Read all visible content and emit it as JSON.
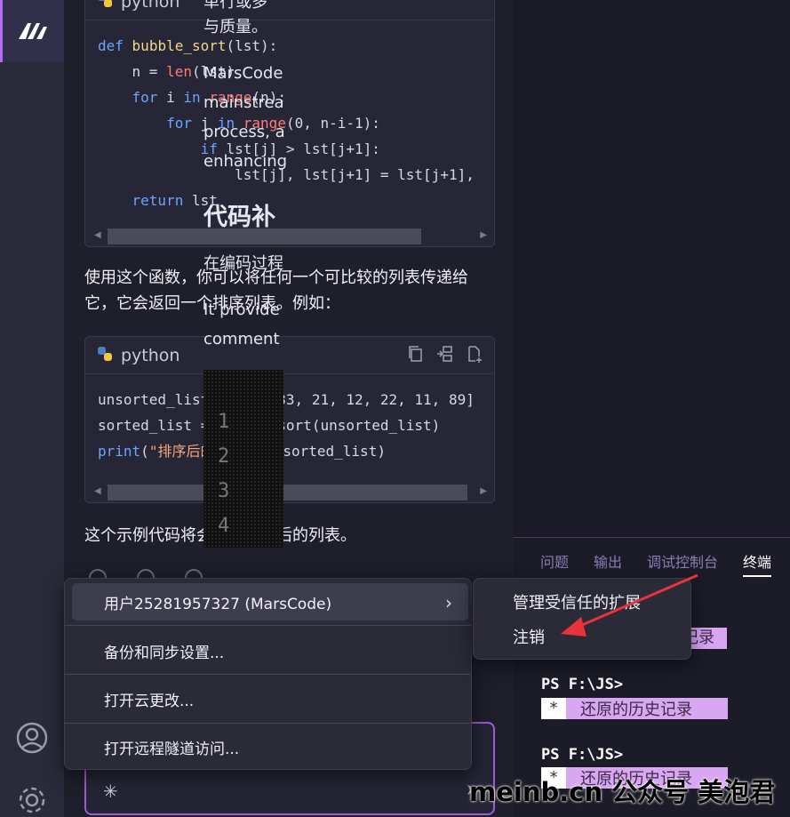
{
  "chat": {
    "code1": {
      "lang": "python",
      "lines": [
        [
          "def",
          "bubble_sort",
          "(lst):"
        ],
        [
          "n = ",
          "len",
          "(lst)"
        ],
        [
          "for",
          " i ",
          "in",
          "range",
          "(n):"
        ],
        [
          "for",
          " j ",
          "in",
          "range",
          "(0, n-i-1):"
        ],
        [
          "if",
          " lst[j] > lst[j+1]:"
        ],
        [
          "lst[j], lst[j+1] = lst[j+1],"
        ],
        [
          "return",
          " lst"
        ]
      ]
    },
    "text1": "使用这个函数，你可以将任何一个可比较的列表传递给它，它会返回一个排序列表。例如：",
    "code2": {
      "lang": "python",
      "line1": "unsorted_list = [64, 33, 21, 12, 22, 11, 89]",
      "line2": "sorted_list = bubble_sort(unsorted_list)",
      "line3_fn": "print",
      "line3_str": "\"排序后的列表：\"",
      "line3_rest": ", sorted_list)"
    },
    "text2": "这个示例代码将会输出排序后的列表。"
  },
  "doc": {
    "p0": "单行或多",
    "p1": "与质量。",
    "p2a": "MarsCode",
    "p2b": "mainstrea",
    "p2c": "process, a",
    "p2d": "enhancing",
    "heading": "代码补",
    "p3": "在编码过程",
    "p4a": "It provide",
    "p4b": "comment",
    "line_numbers": [
      "1",
      "2",
      "3",
      "4"
    ]
  },
  "panel": {
    "tabs": [
      "问题",
      "输出",
      "调试控制台",
      "终端"
    ],
    "prompt": "PS F:\\JS>",
    "history_star": "*",
    "history_label": "还原的历史记录",
    "history_partial": "记录"
  },
  "account_menu": {
    "user": "用户25281957327 (MarsCode)",
    "backup": "备份和同步设置...",
    "cloud": "打开云更改...",
    "tunnel": "打开远程隧道访问..."
  },
  "submenu": {
    "manage": "管理受信任的扩展",
    "logout": "注销"
  },
  "watermark": "meinb.cn  公众号 美泡君",
  "colors": {
    "accent": "#b56cf0",
    "annotation_arrow": "#e8333b",
    "history_bg": "#d9a6f2"
  }
}
